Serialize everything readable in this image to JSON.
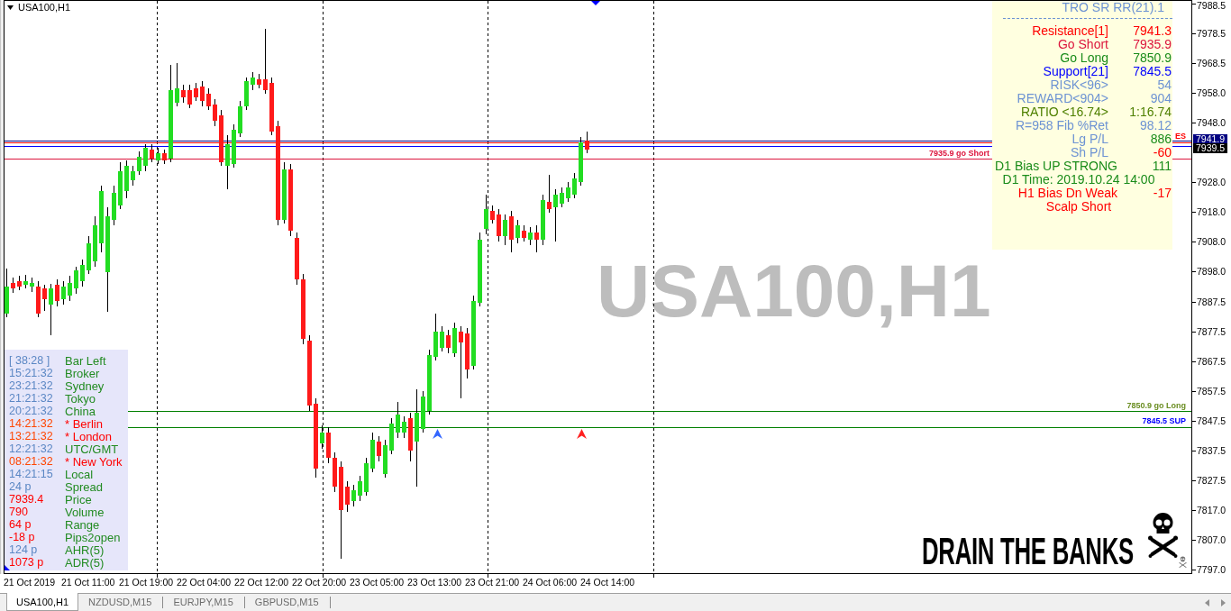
{
  "chart": {
    "symbol": "USA100,H1",
    "watermark": "USA100,H1",
    "banner": "DRAIN THE BANKS",
    "level_labels": [
      {
        "text": "ES",
        "color": "#ff0000"
      },
      {
        "text": "7935.9 go Short",
        "color": "#dc143c"
      },
      {
        "text": "7850.9 go Long",
        "color": "#6b8e23"
      },
      {
        "text": "7845.5 SUP",
        "color": "#0000ff"
      }
    ],
    "price_axis": [
      "7988.5",
      "7978.5",
      "7968.5",
      "7958.0",
      "7948.0",
      "7928.0",
      "7918.0",
      "7908.0",
      "7898.0",
      "7887.5",
      "7877.5",
      "7867.5",
      "7857.5",
      "7847.5",
      "7837.5",
      "7827.5",
      "7817.0",
      "7807.0",
      "7797.0"
    ],
    "price_tags": [
      {
        "text": "7941.9",
        "color": "#000080"
      },
      {
        "text": "7939.5",
        "color": "#000000"
      }
    ],
    "time_axis": [
      "21 Oct 2019",
      "21 Oct 11:00",
      "21 Oct 19:00",
      "22 Oct 04:00",
      "22 Oct 12:00",
      "22 Oct 20:00",
      "23 Oct 05:00",
      "23 Oct 13:00",
      "23 Oct 21:00",
      "24 Oct 06:00",
      "24 Oct 14:00"
    ]
  },
  "sr_panel": {
    "title": "TRO SR RR(21).1",
    "rows": [
      {
        "kind": "pair",
        "label": {
          "text": "Resistance[1]",
          "color": "#ff0000"
        },
        "value": {
          "text": "7941.3",
          "color": "#ff0000"
        }
      },
      {
        "kind": "pair",
        "label": {
          "text": "Go Short",
          "color": "#dc143c"
        },
        "value": {
          "text": "7935.9",
          "color": "#dc143c"
        }
      },
      {
        "kind": "pair",
        "label": {
          "text": "Go Long",
          "color": "#1a8c1a"
        },
        "value": {
          "text": "7850.9",
          "color": "#1a8c1a"
        }
      },
      {
        "kind": "pair",
        "label": {
          "text": "Support[21]",
          "color": "#0000ff"
        },
        "value": {
          "text": "7845.5",
          "color": "#0000ff"
        }
      },
      {
        "kind": "pair",
        "label": {
          "text": "RISK<96>",
          "color": "#6d93d3"
        },
        "value": {
          "text": "54",
          "color": "#6d93d3"
        }
      },
      {
        "kind": "pair",
        "label": {
          "text": "REWARD<904>",
          "color": "#6d93d3"
        },
        "value": {
          "text": "904",
          "color": "#6d93d3"
        }
      },
      {
        "kind": "pair",
        "label": {
          "text": "RATIO <16.74>",
          "color": "#4f8000"
        },
        "value": {
          "text": "1:16.74",
          "color": "#4f8000"
        }
      },
      {
        "kind": "pair",
        "label": {
          "text": "R=958 Fib %Ret",
          "color": "#6d93d3"
        },
        "value": {
          "text": "98.12",
          "color": "#6d93d3"
        }
      },
      {
        "kind": "pair",
        "label": {
          "text": "Lg P/L",
          "color": "#6d93d3"
        },
        "value": {
          "text": "886",
          "color": "#1a8c1a"
        }
      },
      {
        "kind": "pair",
        "label": {
          "text": "Sh P/L",
          "color": "#6d93d3"
        },
        "value": {
          "text": "-60",
          "color": "#ff0000"
        }
      },
      {
        "kind": "bias",
        "label": {
          "text": "D1 Bias UP STRONG",
          "color": "#1a8c1a"
        },
        "value": {
          "text": "111",
          "color": "#1a8c1a"
        }
      },
      {
        "kind": "note",
        "label": {
          "text": "D1 Time: 2019.10.24 14:00",
          "color": "#1a8c1a"
        }
      },
      {
        "kind": "bias",
        "label": {
          "text": "H1 Bias Dn Weak",
          "color": "#ff0000"
        },
        "value": {
          "text": "-17",
          "color": "#ff0000"
        }
      },
      {
        "kind": "note",
        "label": {
          "text": "Scalp Short",
          "color": "#ff0000"
        }
      }
    ]
  },
  "clock_panel": {
    "rows": [
      {
        "label": "Bar Left",
        "value": "[ 38:28 ]",
        "color": "#5b87c4",
        "active": false
      },
      {
        "label": "Broker",
        "value": "15:21:32",
        "color": "#5b87c4",
        "active": false
      },
      {
        "label": "Sydney",
        "value": "23:21:32",
        "color": "#5b87c4",
        "active": false
      },
      {
        "label": "Tokyo",
        "value": "21:21:32",
        "color": "#5b87c4",
        "active": false
      },
      {
        "label": "China",
        "value": "20:21:32",
        "color": "#5b87c4",
        "active": false
      },
      {
        "label": "* Berlin",
        "value": "14:21:32",
        "color": "#ff4500",
        "active": true
      },
      {
        "label": "* London",
        "value": "13:21:32",
        "color": "#ff4500",
        "active": true
      },
      {
        "label": "UTC/GMT",
        "value": "12:21:32",
        "color": "#5b87c4",
        "active": false
      },
      {
        "label": "* New York",
        "value": "08:21:32",
        "color": "#ff4500",
        "active": true
      },
      {
        "label": "Local",
        "value": "14:21:15",
        "color": "#5b87c4",
        "active": false
      },
      {
        "label": "Spread",
        "value": "24 p",
        "color": "#5b87c4",
        "active": false
      },
      {
        "label": "Price",
        "value": "7939.4",
        "color": "#ff0000",
        "active": false
      },
      {
        "label": "Volume",
        "value": "790",
        "color": "#ff0000",
        "active": false
      },
      {
        "label": "Range",
        "value": "64 p",
        "color": "#ff0000",
        "active": false
      },
      {
        "label": "Pips2open",
        "value": "-18 p",
        "color": "#ff0000",
        "active": false
      },
      {
        "label": "AHR(5)",
        "value": "124 p",
        "color": "#5b87c4",
        "active": false
      },
      {
        "label": "ADR(5)",
        "value": "1073 p",
        "color": "#ff0000",
        "active": false
      }
    ]
  },
  "tabs": [
    {
      "label": "USA100,H1",
      "selected": true
    },
    {
      "label": "NZDUSD,M15",
      "selected": false
    },
    {
      "label": "EURJPY,M15",
      "selected": false
    },
    {
      "label": "GBPUSD,M15",
      "selected": false
    }
  ]
}
